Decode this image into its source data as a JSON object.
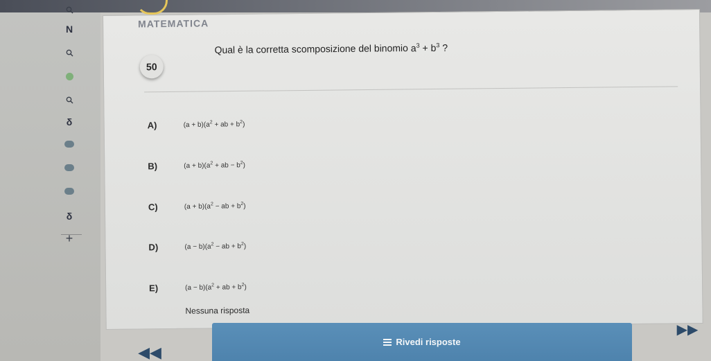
{
  "header": {
    "subject": "MATEMATICA"
  },
  "sidebar": {
    "icons": [
      "search-icon",
      "bold-n-icon",
      "search-icon",
      "status-dot-icon",
      "search-icon",
      "partial-icon",
      "time-pill-icon",
      "time-pill-icon",
      "time-pill-icon",
      "partial-icon",
      "add-icon"
    ]
  },
  "question": {
    "number": "50",
    "text": "Qual è la corretta scomposizione del binomio",
    "formula_a": "a",
    "formula_exp1": "3",
    "formula_plus": " + ",
    "formula_b": "b",
    "formula_exp2": "3",
    "formula_end": " ?"
  },
  "options": [
    {
      "letter": "A)",
      "p1": "(a + b)(a",
      "exp1": "2",
      "p2": " + ab + b",
      "exp2": "2",
      "p3": ")"
    },
    {
      "letter": "B)",
      "p1": "(a + b)(a",
      "exp1": "2",
      "p2": " + ab − b",
      "exp2": "2",
      "p3": ")"
    },
    {
      "letter": "C)",
      "p1": "(a + b)(a",
      "exp1": "2",
      "p2": " − ab + b",
      "exp2": "2",
      "p3": ")"
    },
    {
      "letter": "D)",
      "p1": "(a − b)(a",
      "exp1": "2",
      "p2": " − ab + b",
      "exp2": "2",
      "p3": ")"
    },
    {
      "letter": "E)",
      "p1": "(a − b)(a",
      "exp1": "2",
      "p2": " + ab + b",
      "exp2": "2",
      "p3": ")"
    }
  ],
  "no_answer": "Nessuna risposta",
  "footer": {
    "review_label": "Rivedi risposte",
    "prev_glyph": "◀◀",
    "next_glyph": "▶▶"
  },
  "colors": {
    "primary": "#5a8fb8",
    "nav_arrows": "#2d4b6a"
  }
}
